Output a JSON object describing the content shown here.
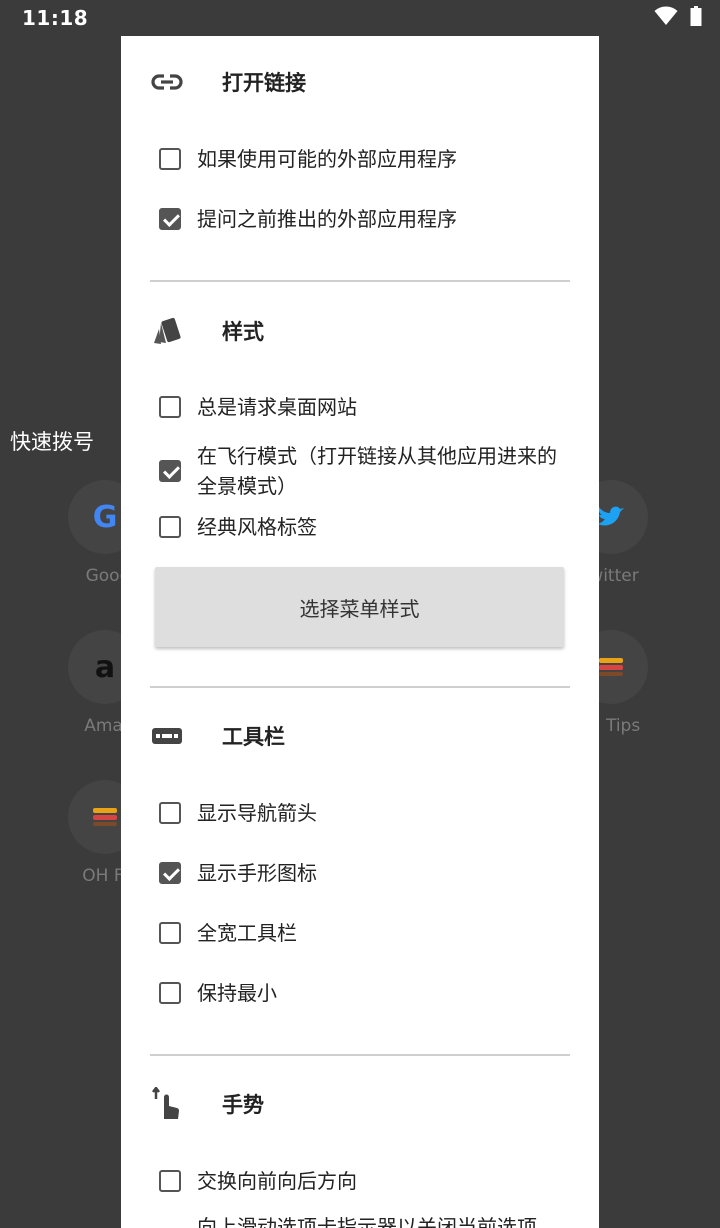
{
  "status_bar": {
    "time": "11:18"
  },
  "background": {
    "section_title": "快速拨号",
    "tiles": [
      {
        "label": "Goog",
        "glyph": "G"
      },
      {
        "label": "witter",
        "glyph": ""
      },
      {
        "label": "Amaz",
        "glyph": "a"
      },
      {
        "label": "H Tips",
        "glyph": ""
      },
      {
        "label": "OH FA",
        "glyph": ""
      }
    ]
  },
  "dialog": {
    "sections": [
      {
        "title": "打开链接",
        "icon": "link-icon",
        "options": [
          {
            "label": "如果使用可能的外部应用程序",
            "checked": false
          },
          {
            "label": "提问之前推出的外部应用程序",
            "checked": true
          }
        ]
      },
      {
        "title": "样式",
        "icon": "palette-swatch-icon",
        "options": [
          {
            "label": "总是请求桌面网站",
            "checked": false
          },
          {
            "label": "在飞行模式（打开链接从其他应用进来的全景模式）",
            "checked": true
          },
          {
            "label": "经典风格标签",
            "checked": false
          }
        ],
        "button_label": "选择菜单样式"
      },
      {
        "title": "工具栏",
        "icon": "toolbar-icon",
        "options": [
          {
            "label": "显示导航箭头",
            "checked": false
          },
          {
            "label": "显示手形图标",
            "checked": true
          },
          {
            "label": "全宽工具栏",
            "checked": false
          },
          {
            "label": "保持最小",
            "checked": false
          }
        ]
      },
      {
        "title": "手势",
        "icon": "swipe-up-gesture-icon",
        "options": [
          {
            "label": "交换向前向后方向",
            "checked": false
          },
          {
            "label": "向上滑动选项卡指示器以关闭当前选项",
            "checked": false
          }
        ]
      }
    ]
  },
  "colors": {
    "scrim": "#3b3b3b",
    "dialog_bg": "#ffffff",
    "checkbox": "#555555",
    "button_bg": "#dedede"
  }
}
